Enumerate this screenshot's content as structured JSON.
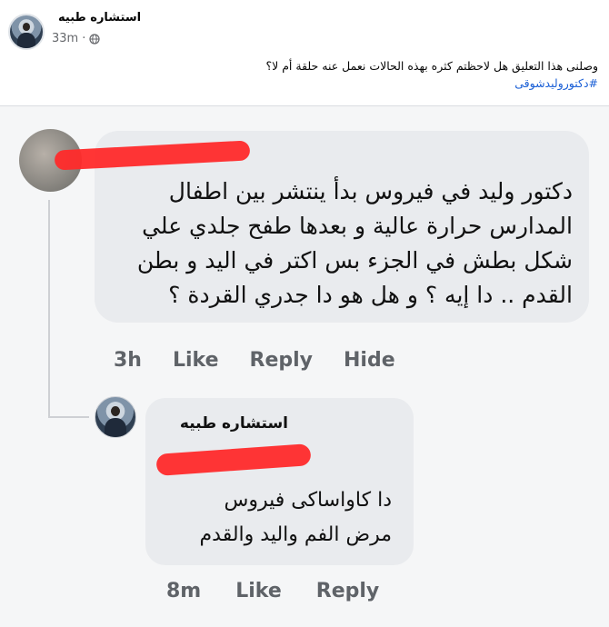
{
  "post": {
    "author": "استشاره طبيه",
    "time": "33m",
    "text": "وصلنى هذا التعليق هل لاحظتم كثره بهذه الحالات نعمل عنه حلقة أم لا؟",
    "hashtag": "#دكتوروليدشوقى"
  },
  "comments": [
    {
      "text": "دكتور وليد في فيروس بدأ ينتشر بين اطفال المدارس حرارة عالية و بعدها طفح جلدي علي شكل بطش في الجزء بس اكتر في اليد و بطن القدم .. دا إيه ؟ و هل هو دا جدري القردة ؟",
      "time": "3h",
      "like": "Like",
      "reply": "Reply",
      "hide": "Hide"
    },
    {
      "author": "استشاره طبيه",
      "text_line1": "دا كاواساكى فيروس",
      "text_line2": "مرض الفم واليد والقدم",
      "time": "8m",
      "like": "Like",
      "reply": "Reply"
    }
  ],
  "icons": {
    "privacy": "globe-icon"
  },
  "colors": {
    "redaction": "#ff2a2a",
    "hashtag": "#1a5fd6",
    "bubble": "#e9ebee"
  }
}
